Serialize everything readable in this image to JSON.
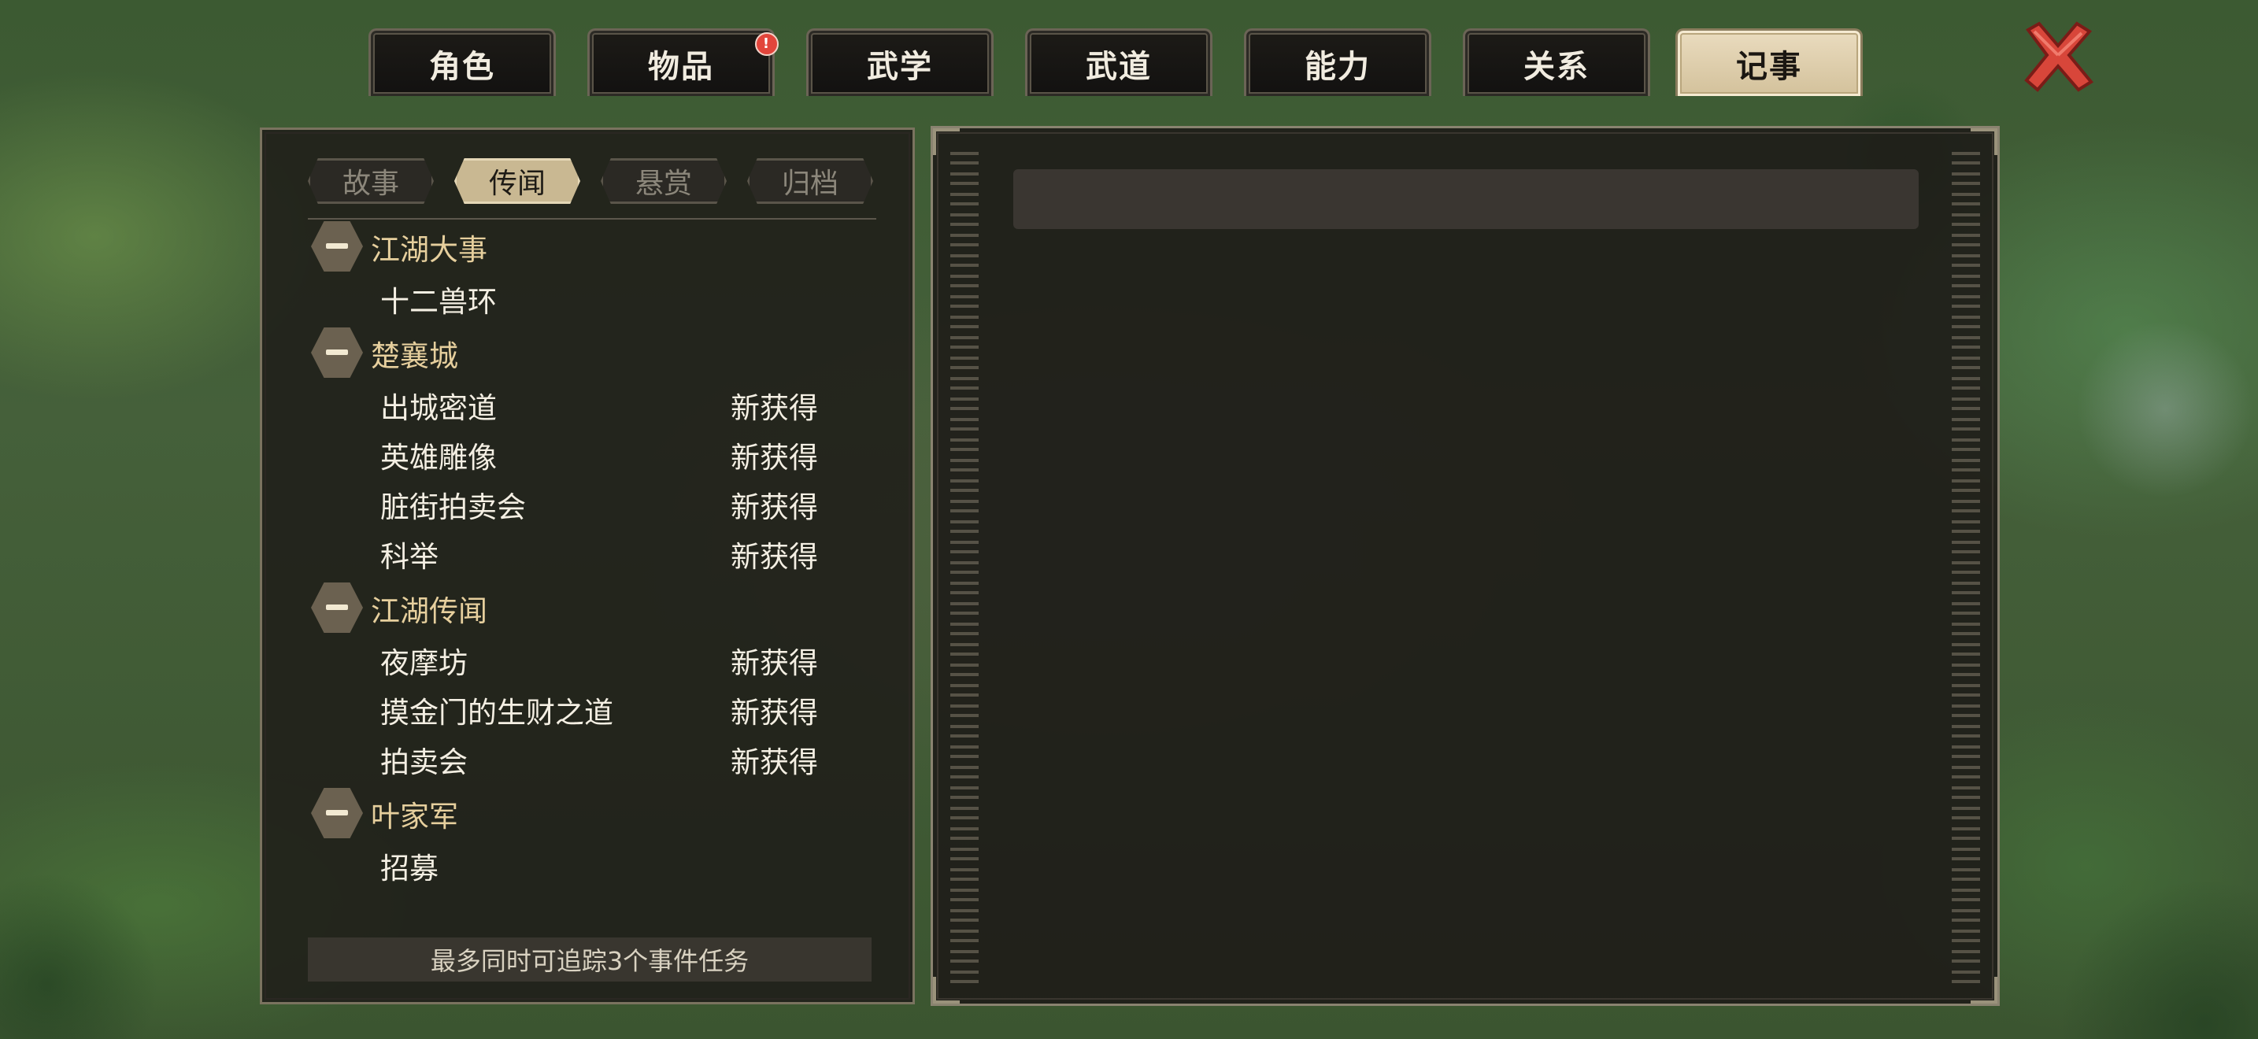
{
  "top_tabs": [
    {
      "label": "角色",
      "active": false,
      "badge": ""
    },
    {
      "label": "物品",
      "active": false,
      "badge": "!"
    },
    {
      "label": "武学",
      "active": false,
      "badge": ""
    },
    {
      "label": "武道",
      "active": false,
      "badge": ""
    },
    {
      "label": "能力",
      "active": false,
      "badge": ""
    },
    {
      "label": "关系",
      "active": false,
      "badge": ""
    },
    {
      "label": "记事",
      "active": true,
      "badge": ""
    }
  ],
  "close_icon": "close-x-icon",
  "sub_tabs": [
    {
      "label": "故事",
      "active": false
    },
    {
      "label": "传闻",
      "active": true
    },
    {
      "label": "悬赏",
      "active": false
    },
    {
      "label": "归档",
      "active": false
    }
  ],
  "groups": [
    {
      "title": "江湖大事",
      "items": [
        {
          "name": "十二兽环",
          "status": ""
        }
      ]
    },
    {
      "title": "楚襄城",
      "items": [
        {
          "name": "出城密道",
          "status": "新获得"
        },
        {
          "name": "英雄雕像",
          "status": "新获得"
        },
        {
          "name": "脏街拍卖会",
          "status": "新获得"
        },
        {
          "name": "科举",
          "status": "新获得"
        }
      ]
    },
    {
      "title": "江湖传闻",
      "items": [
        {
          "name": "夜摩坊",
          "status": "新获得"
        },
        {
          "name": "摸金门的生财之道",
          "status": "新获得"
        },
        {
          "name": "拍卖会",
          "status": "新获得"
        }
      ]
    },
    {
      "title": "叶家军",
      "items": [
        {
          "name": "招募",
          "status": ""
        }
      ]
    }
  ],
  "footer_note": "最多同时可追踪3个事件任务",
  "colors": {
    "accent": "#e6cf9d",
    "active_tab": "#d9c8a3",
    "badge": "#e2453b",
    "close": "#d8463a"
  }
}
